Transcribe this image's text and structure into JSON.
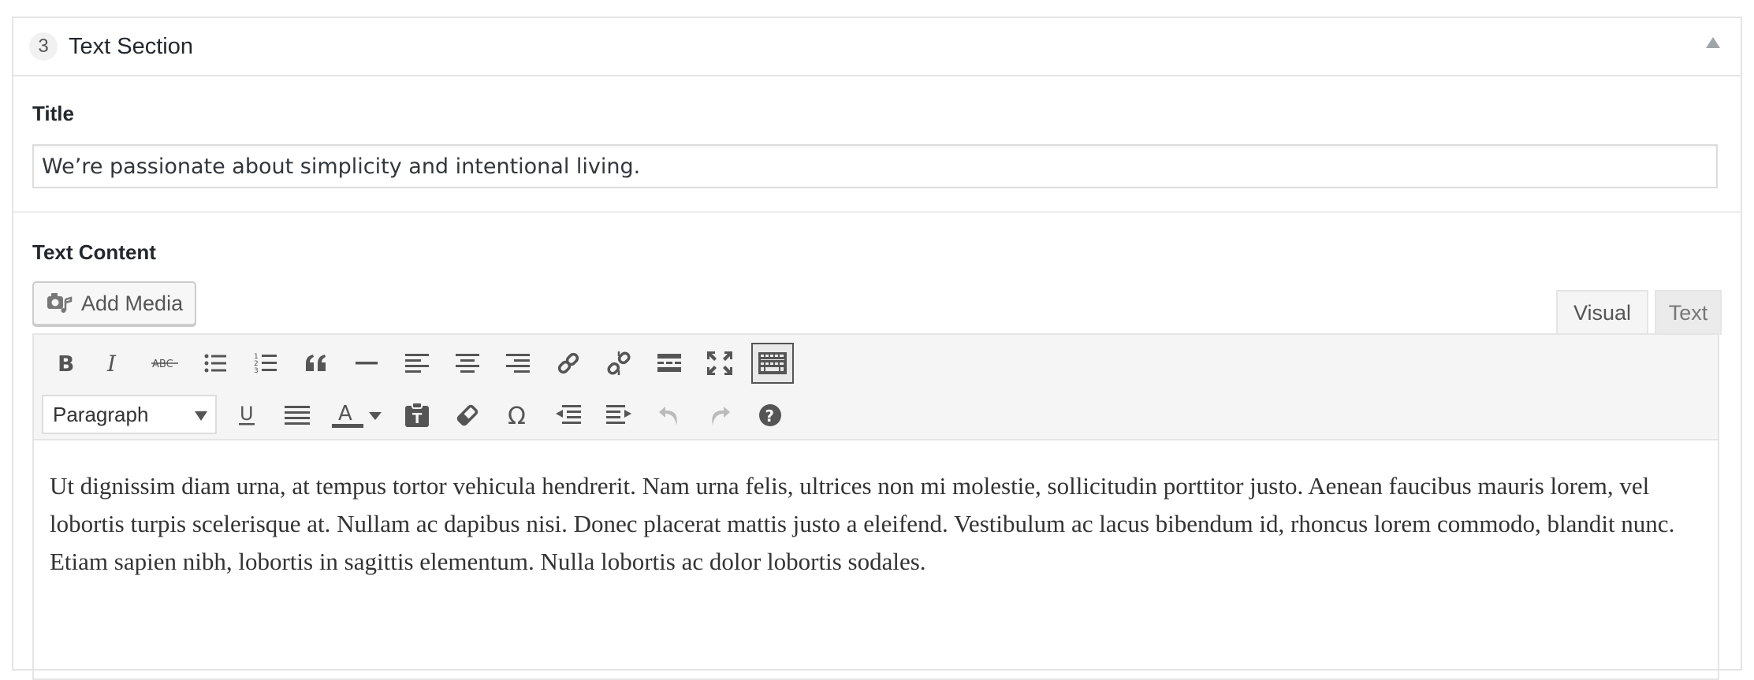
{
  "section": {
    "number": "3",
    "title": "Text Section"
  },
  "fields": {
    "title_label": "Title",
    "title_value": "We’re passionate about simplicity and intentional living.",
    "content_label": "Text Content"
  },
  "editor": {
    "add_media_label": "Add Media",
    "tabs": {
      "visual": "Visual",
      "text": "Text"
    },
    "format_select_value": "Paragraph",
    "body_text": "Ut dignissim diam urna, at tempus tortor vehicula hendrerit. Nam urna felis, ultrices non mi molestie, sollicitudin porttitor justo. Aenean faucibus mauris lorem, vel lobortis turpis scelerisque at. Nullam ac dapibus nisi. Donec placerat mattis justo a eleifend. Vestibulum ac lacus bibendum id, rhoncus lorem commodo, blandit nunc. Etiam sapien nibh, lobortis in sagittis elementum. Nulla lobortis ac dolor lobortis sodales.",
    "toolbar_row1": [
      "bold-icon",
      "italic-icon",
      "strikethrough-icon",
      "bulleted-list-icon",
      "numbered-list-icon",
      "blockquote-icon",
      "horizontal-line-icon",
      "align-left-icon",
      "align-center-icon",
      "align-right-icon",
      "link-icon",
      "unlink-icon",
      "read-more-icon",
      "fullscreen-icon",
      "toolbar-toggle-icon"
    ],
    "toolbar_row2": [
      "underline-icon",
      "justify-icon",
      "text-color-icon",
      "text-color-dropdown-icon",
      "paste-as-text-icon",
      "clear-formatting-icon",
      "special-character-icon",
      "outdent-icon",
      "indent-icon",
      "undo-icon",
      "redo-icon",
      "help-icon"
    ]
  },
  "colors": {
    "border": "#e5e5e5",
    "toolbar_bg": "#f5f5f5",
    "icon": "#555555",
    "disabled_icon": "#bbbbbb"
  }
}
